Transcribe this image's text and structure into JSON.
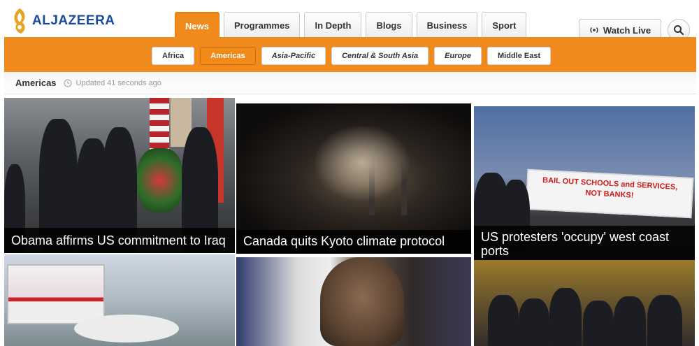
{
  "logo": {
    "text": "ALJAZEERA"
  },
  "main_tabs": [
    {
      "label": "News",
      "active": true
    },
    {
      "label": "Programmes",
      "active": false
    },
    {
      "label": "In Depth",
      "active": false
    },
    {
      "label": "Blogs",
      "active": false
    },
    {
      "label": "Business",
      "active": false
    },
    {
      "label": "Sport",
      "active": false
    }
  ],
  "watch_live": {
    "label": "Watch Live",
    "icon": "broadcast-icon"
  },
  "search": {
    "icon": "search-icon"
  },
  "sub_tabs": [
    {
      "label": "Africa",
      "active": false
    },
    {
      "label": "Americas",
      "active": true
    },
    {
      "label": "Asia-Pacific",
      "active": false
    },
    {
      "label": "Central & South Asia",
      "active": false
    },
    {
      "label": "Europe",
      "active": false
    },
    {
      "label": "Middle East",
      "active": false
    }
  ],
  "section": {
    "title": "Americas",
    "updated": "Updated 41 seconds ago",
    "clock_icon": "clock-icon"
  },
  "stories": [
    {
      "headline": "Obama affirms US commitment to Iraq"
    },
    {
      "headline": "Canada quits Kyoto climate protocol"
    },
    {
      "headline": "US protesters 'occupy' west coast ports"
    },
    {
      "headline": ""
    },
    {
      "headline": ""
    },
    {
      "headline": ""
    }
  ],
  "banner": {
    "text1": "BAIL OUT SCHOOLS and SERVICES,",
    "text2": "NOT BANKS!"
  },
  "colors": {
    "brand_orange": "#f08a1c",
    "logo_blue": "#1a4c9c",
    "logo_gold": "#e8a323"
  }
}
